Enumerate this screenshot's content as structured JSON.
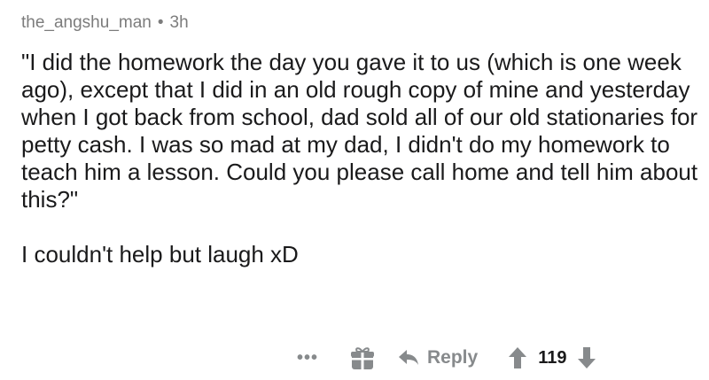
{
  "comment": {
    "author": "the_angshu_man",
    "separator": "•",
    "time": "3h",
    "paragraphs": [
      "\"I did the homework the day you gave it to us (which is one week ago), except that I did in an old rough copy of mine and yesterday when I got back from school, dad sold all of our old stationaries for petty cash. I was so mad at my dad, I didn't do my homework to teach him a lesson. Could you please call home and tell him about this?\"",
      "I couldn't help but laugh xD"
    ]
  },
  "actions": {
    "more_label": "•••",
    "reply_label": "Reply",
    "score": "119"
  },
  "icons": {
    "more": "more-options-icon",
    "award": "gift-award-icon",
    "reply": "reply-arrow-icon",
    "upvote": "upvote-arrow-icon",
    "downvote": "downvote-arrow-icon"
  },
  "colors": {
    "meta_text": "#7c7c7c",
    "body_text": "#1a1a1b",
    "action_gray": "#878a8c"
  }
}
